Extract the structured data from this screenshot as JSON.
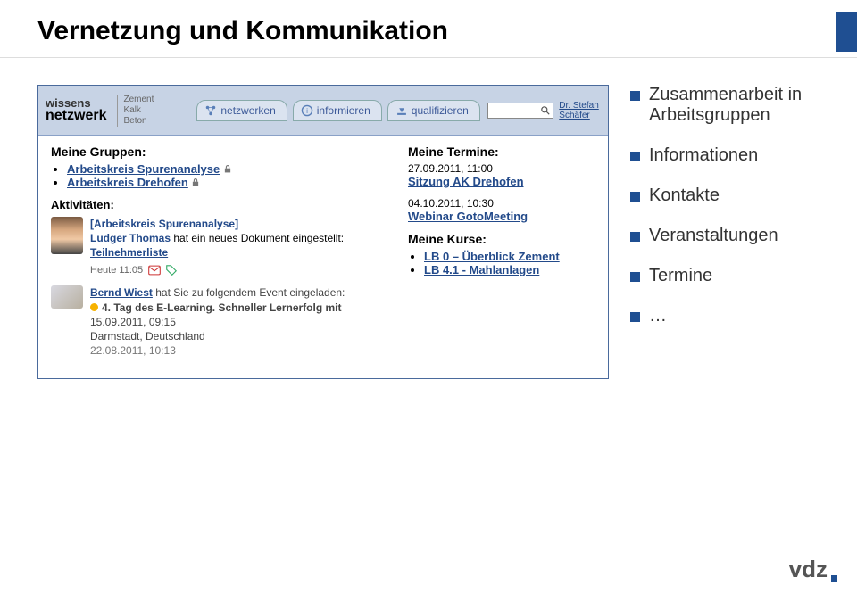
{
  "slide": {
    "title": "Vernetzung und Kommunikation"
  },
  "panel": {
    "logo": {
      "line1": "wissens",
      "line2": "netzwerk",
      "mats": [
        "Zement",
        "Kalk",
        "Beton"
      ]
    },
    "nav": {
      "netzwerken": "netzwerken",
      "informieren": "informieren",
      "qualifizieren": "qualifizieren"
    },
    "profile": "Dr. Stefan Schäfer",
    "left": {
      "groups_heading": "Meine Gruppen:",
      "groups": [
        "Arbeitskreis Spurenanalyse",
        "Arbeitskreis Drehofen"
      ],
      "activities_heading": "Aktivitäten:",
      "act1": {
        "group": "[Arbeitskreis Spurenanalyse]",
        "actor": "Ludger Thomas",
        "tail": " hat ein neues Dokument eingestellt: ",
        "doc": "Teilnehmerliste",
        "meta_time": "Heute 11:05"
      },
      "act2": {
        "actor": "Bernd Wiest",
        "tail": " hat Sie zu folgendem Event eingeladen:",
        "event": "4. Tag des E-Learning. Schneller Lernerfolg mit",
        "when": "15.09.2011, 09:15",
        "where": "Darmstadt, Deutschland",
        "posted": "22.08.2011, 10:13"
      }
    },
    "right": {
      "termine_heading": "Meine Termine:",
      "t1_time": "27.09.2011, 11:00",
      "t1_label": "Sitzung AK Drehofen",
      "t2_time": "04.10.2011, 10:30",
      "t2_label": "Webinar GotoMeeting",
      "kurse_heading": "Meine Kurse:",
      "kurse": [
        "LB 0 – Überblick Zement",
        "LB 4.1 - Mahlanlagen"
      ]
    }
  },
  "bullets": {
    "b1": "Zusammenarbeit in Arbeitsgruppen",
    "b2": "Informationen",
    "b3": "Kontakte",
    "b4": "Veranstaltungen",
    "b5": "Termine",
    "b6": "…"
  },
  "footer": {
    "brand": "vdz"
  }
}
